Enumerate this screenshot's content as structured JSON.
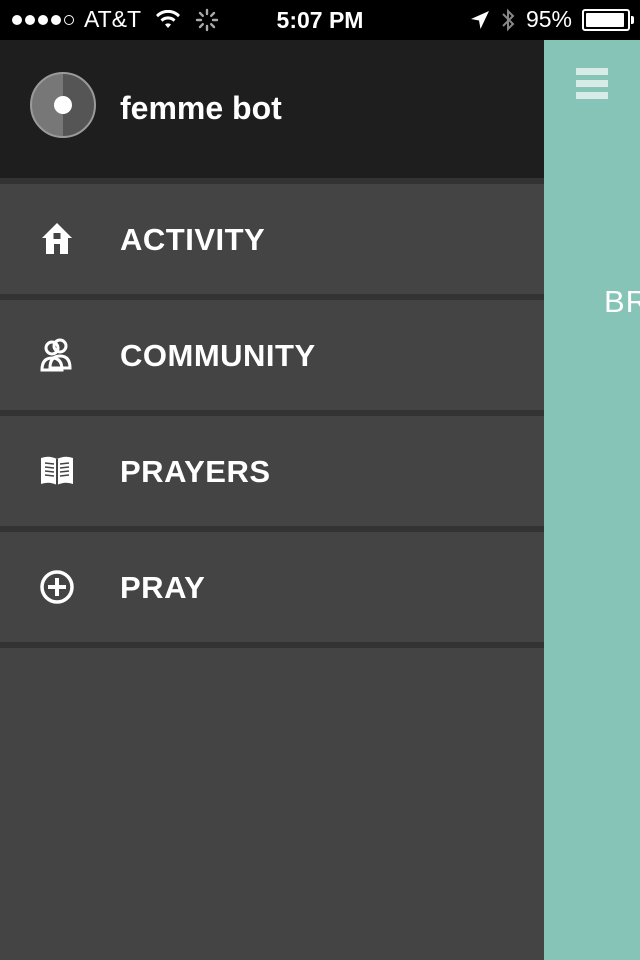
{
  "status_bar": {
    "carrier": "AT&T",
    "time": "5:07 PM",
    "battery": "95%"
  },
  "profile": {
    "username": "femme bot"
  },
  "menu": {
    "items": [
      {
        "label": "ACTIVITY",
        "icon": "home-icon"
      },
      {
        "label": "COMMUNITY",
        "icon": "people-icon"
      },
      {
        "label": "PRAYERS",
        "icon": "book-icon"
      },
      {
        "label": "PRAY",
        "icon": "plus-circle-icon"
      }
    ]
  },
  "content": {
    "peek_text": "BR"
  },
  "colors": {
    "drawer_bg": "#444444",
    "profile_bg": "#1e1e1e",
    "content_bg": "#86c4b8"
  }
}
